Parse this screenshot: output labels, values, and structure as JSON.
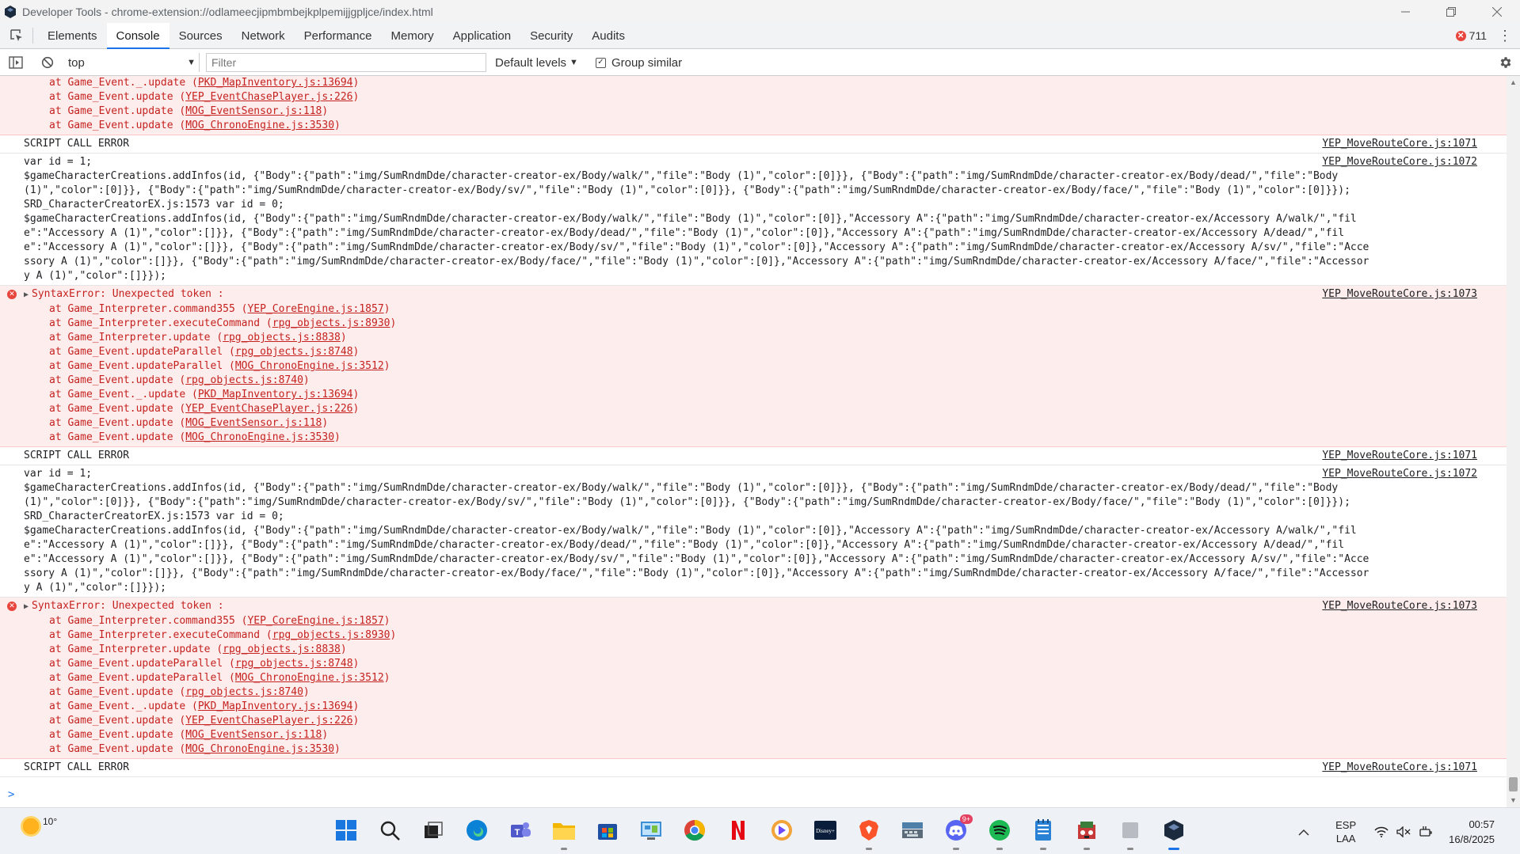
{
  "window": {
    "title": "Developer Tools - chrome-extension://odlameecjipmbmbejkplpemijjgpljce/index.html",
    "controls": [
      "minimize",
      "restore",
      "close"
    ]
  },
  "tabs": [
    {
      "label": "Elements"
    },
    {
      "label": "Console",
      "active": true
    },
    {
      "label": "Sources"
    },
    {
      "label": "Network"
    },
    {
      "label": "Performance"
    },
    {
      "label": "Memory"
    },
    {
      "label": "Application"
    },
    {
      "label": "Security"
    },
    {
      "label": "Audits"
    }
  ],
  "error_count": "711",
  "toolbar": {
    "context": "top",
    "filter_placeholder": "Filter",
    "levels": "Default levels",
    "group_similar": "Group similar",
    "group_similar_checked": true
  },
  "console": {
    "messages": [
      {
        "type": "err-cont",
        "src": "",
        "stack": [
          [
            "at Game_Event._.update (",
            "PKD_MapInventory.js:13694",
            ")"
          ],
          [
            "at Game_Event.update (",
            "YEP_EventChasePlayer.js:226",
            ")"
          ],
          [
            "at Game_Event.update (",
            "MOG_EventSensor.js:118",
            ")"
          ],
          [
            "at Game_Event.update (",
            "MOG_ChronoEngine.js:3530",
            ")"
          ]
        ]
      },
      {
        "type": "log",
        "text": "SCRIPT CALL ERROR",
        "src": "YEP_MoveRouteCore.js:1071"
      },
      {
        "type": "logwrap",
        "src": "YEP_MoveRouteCore.js:1072",
        "text": "var id = 1;\n$gameCharacterCreations.addInfos(id, {\"Body\":{\"path\":\"img/SumRndmDde/character-creator-ex/Body/walk/\",\"file\":\"Body (1)\",\"color\":[0]}}, {\"Body\":{\"path\":\"img/SumRndmDde/character-creator-ex/Body/dead/\",\"file\":\"Body (1)\",\"color\":[0]}}, {\"Body\":{\"path\":\"img/SumRndmDde/character-creator-ex/Body/sv/\",\"file\":\"Body (1)\",\"color\":[0]}}, {\"Body\":{\"path\":\"img/SumRndmDde/character-creator-ex/Body/face/\",\"file\":\"Body (1)\",\"color\":[0]}});\nSRD_CharacterCreatorEX.js:1573 var id = 0;\n$gameCharacterCreations.addInfos(id, {\"Body\":{\"path\":\"img/SumRndmDde/character-creator-ex/Body/walk/\",\"file\":\"Body (1)\",\"color\":[0]},\"Accessory A\":{\"path\":\"img/SumRndmDde/character-creator-ex/Accessory A/walk/\",\"file\":\"Accessory A (1)\",\"color\":[]}}, {\"Body\":{\"path\":\"img/SumRndmDde/character-creator-ex/Body/dead/\",\"file\":\"Body (1)\",\"color\":[0]},\"Accessory A\":{\"path\":\"img/SumRndmDde/character-creator-ex/Accessory A/dead/\",\"file\":\"Accessory A (1)\",\"color\":[]}}, {\"Body\":{\"path\":\"img/SumRndmDde/character-creator-ex/Body/sv/\",\"file\":\"Body (1)\",\"color\":[0]},\"Accessory A\":{\"path\":\"img/SumRndmDde/character-creator-ex/Accessory A/sv/\",\"file\":\"Accessory A (1)\",\"color\":[]}}, {\"Body\":{\"path\":\"img/SumRndmDde/character-creator-ex/Body/face/\",\"file\":\"Body (1)\",\"color\":[0]},\"Accessory A\":{\"path\":\"img/SumRndmDde/character-creator-ex/Accessory A/face/\",\"file\":\"Accessory A (1)\",\"color\":[]}});"
      },
      {
        "type": "err",
        "head": "SyntaxError: Unexpected token :",
        "src": "YEP_MoveRouteCore.js:1073",
        "stack": [
          [
            "at Game_Interpreter.command355 (",
            "YEP_CoreEngine.js:1857",
            ")"
          ],
          [
            "at Game_Interpreter.executeCommand (",
            "rpg_objects.js:8930",
            ")"
          ],
          [
            "at Game_Interpreter.update (",
            "rpg_objects.js:8838",
            ")"
          ],
          [
            "at Game_Event.updateParallel (",
            "rpg_objects.js:8748",
            ")"
          ],
          [
            "at Game_Event.updateParallel (",
            "MOG_ChronoEngine.js:3512",
            ")"
          ],
          [
            "at Game_Event.update (",
            "rpg_objects.js:8740",
            ")"
          ],
          [
            "at Game_Event._.update (",
            "PKD_MapInventory.js:13694",
            ")"
          ],
          [
            "at Game_Event.update (",
            "YEP_EventChasePlayer.js:226",
            ")"
          ],
          [
            "at Game_Event.update (",
            "MOG_EventSensor.js:118",
            ")"
          ],
          [
            "at Game_Event.update (",
            "MOG_ChronoEngine.js:3530",
            ")"
          ]
        ]
      },
      {
        "type": "log",
        "text": "SCRIPT CALL ERROR",
        "src": "YEP_MoveRouteCore.js:1071"
      },
      {
        "type": "logwrap",
        "src": "YEP_MoveRouteCore.js:1072",
        "text": "var id = 1;\n$gameCharacterCreations.addInfos(id, {\"Body\":{\"path\":\"img/SumRndmDde/character-creator-ex/Body/walk/\",\"file\":\"Body (1)\",\"color\":[0]}}, {\"Body\":{\"path\":\"img/SumRndmDde/character-creator-ex/Body/dead/\",\"file\":\"Body (1)\",\"color\":[0]}}, {\"Body\":{\"path\":\"img/SumRndmDde/character-creator-ex/Body/sv/\",\"file\":\"Body (1)\",\"color\":[0]}}, {\"Body\":{\"path\":\"img/SumRndmDde/character-creator-ex/Body/face/\",\"file\":\"Body (1)\",\"color\":[0]}});\nSRD_CharacterCreatorEX.js:1573 var id = 0;\n$gameCharacterCreations.addInfos(id, {\"Body\":{\"path\":\"img/SumRndmDde/character-creator-ex/Body/walk/\",\"file\":\"Body (1)\",\"color\":[0]},\"Accessory A\":{\"path\":\"img/SumRndmDde/character-creator-ex/Accessory A/walk/\",\"file\":\"Accessory A (1)\",\"color\":[]}}, {\"Body\":{\"path\":\"img/SumRndmDde/character-creator-ex/Body/dead/\",\"file\":\"Body (1)\",\"color\":[0]},\"Accessory A\":{\"path\":\"img/SumRndmDde/character-creator-ex/Accessory A/dead/\",\"file\":\"Accessory A (1)\",\"color\":[]}}, {\"Body\":{\"path\":\"img/SumRndmDde/character-creator-ex/Body/sv/\",\"file\":\"Body (1)\",\"color\":[0]},\"Accessory A\":{\"path\":\"img/SumRndmDde/character-creator-ex/Accessory A/sv/\",\"file\":\"Accessory A (1)\",\"color\":[]}}, {\"Body\":{\"path\":\"img/SumRndmDde/character-creator-ex/Body/face/\",\"file\":\"Body (1)\",\"color\":[0]},\"Accessory A\":{\"path\":\"img/SumRndmDde/character-creator-ex/Accessory A/face/\",\"file\":\"Accessory A (1)\",\"color\":[]}});"
      },
      {
        "type": "err",
        "head": "SyntaxError: Unexpected token :",
        "src": "YEP_MoveRouteCore.js:1073",
        "stack": [
          [
            "at Game_Interpreter.command355 (",
            "YEP_CoreEngine.js:1857",
            ")"
          ],
          [
            "at Game_Interpreter.executeCommand (",
            "rpg_objects.js:8930",
            ")"
          ],
          [
            "at Game_Interpreter.update (",
            "rpg_objects.js:8838",
            ")"
          ],
          [
            "at Game_Event.updateParallel (",
            "rpg_objects.js:8748",
            ")"
          ],
          [
            "at Game_Event.updateParallel (",
            "MOG_ChronoEngine.js:3512",
            ")"
          ],
          [
            "at Game_Event.update (",
            "rpg_objects.js:8740",
            ")"
          ],
          [
            "at Game_Event._.update (",
            "PKD_MapInventory.js:13694",
            ")"
          ],
          [
            "at Game_Event.update (",
            "YEP_EventChasePlayer.js:226",
            ")"
          ],
          [
            "at Game_Event.update (",
            "MOG_EventSensor.js:118",
            ")"
          ],
          [
            "at Game_Event.update (",
            "MOG_ChronoEngine.js:3530",
            ")"
          ]
        ]
      },
      {
        "type": "log",
        "text": "SCRIPT CALL ERROR",
        "src": "YEP_MoveRouteCore.js:1071"
      }
    ],
    "prompt": ">"
  },
  "taskbar": {
    "weather_temp": "10°",
    "apps": [
      {
        "name": "start-icon",
        "ind": ""
      },
      {
        "name": "search-icon",
        "ind": ""
      },
      {
        "name": "task-view-icon",
        "ind": ""
      },
      {
        "name": "edge-icon",
        "ind": ""
      },
      {
        "name": "teams-icon",
        "ind": ""
      },
      {
        "name": "file-explorer-icon",
        "ind": "run"
      },
      {
        "name": "microsoft-store-icon",
        "ind": ""
      },
      {
        "name": "control-panel-icon",
        "ind": ""
      },
      {
        "name": "chrome-icon",
        "ind": ""
      },
      {
        "name": "netflix-icon",
        "ind": ""
      },
      {
        "name": "proton-vpn-icon",
        "ind": ""
      },
      {
        "name": "disney-plus-icon",
        "ind": ""
      },
      {
        "name": "brave-icon",
        "ind": "run"
      },
      {
        "name": "keyboard-app-icon",
        "ind": ""
      },
      {
        "name": "discord-icon",
        "ind": "run",
        "badge": "9+"
      },
      {
        "name": "spotify-icon",
        "ind": "run"
      },
      {
        "name": "notepad-icon",
        "ind": "run"
      },
      {
        "name": "game-icon",
        "ind": "run"
      },
      {
        "name": "blank-window-icon",
        "ind": "run"
      },
      {
        "name": "rpgmaker-devtools-icon",
        "ind": "active"
      }
    ],
    "lang_top": "ESP",
    "lang_bottom": "LAA",
    "time": "00:57",
    "date": "16/8/2025"
  },
  "colors": {
    "accent": "#1a73e8",
    "error_bg": "#fdeded",
    "error_text": "#c5221f",
    "error_icon": "#e8453c"
  }
}
